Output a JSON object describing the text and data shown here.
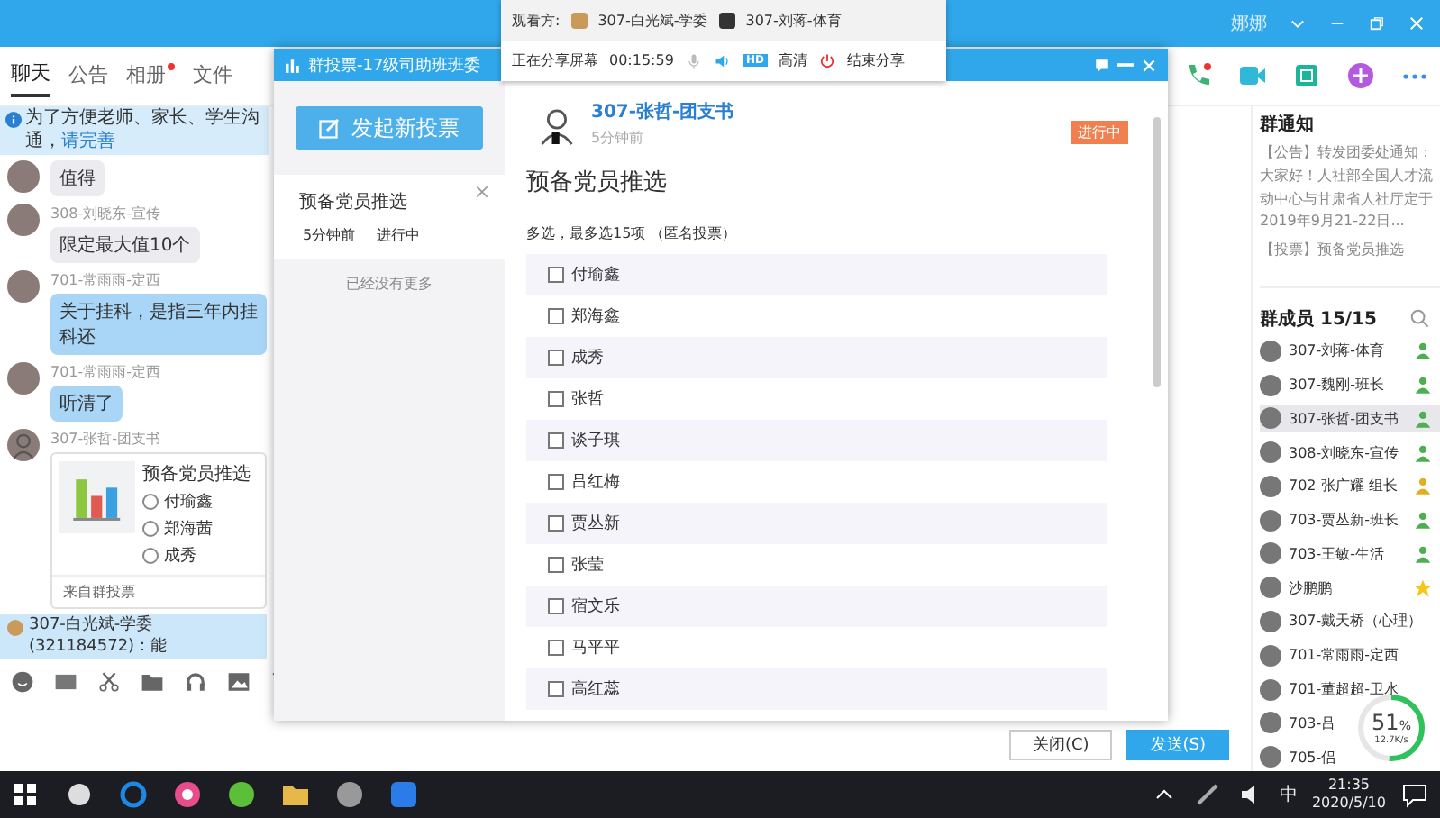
{
  "window": {
    "user": "娜娜"
  },
  "tabs": [
    {
      "label": "聊天",
      "selected": true,
      "has_dot": false
    },
    {
      "label": "公告",
      "selected": false,
      "has_dot": false
    },
    {
      "label": "相册",
      "selected": false,
      "has_dot": true
    },
    {
      "label": "文件",
      "selected": false,
      "has_dot": false
    }
  ],
  "info_bar": {
    "text": "为了方便老师、家长、学生沟通，",
    "link": "请完善"
  },
  "messages": [
    {
      "kind": "text",
      "text": "值得",
      "color": "#ececf0"
    },
    {
      "kind": "text",
      "sender": "308-刘晓东-宣传",
      "text": "限定最大值10个",
      "color": "#ececf0"
    },
    {
      "kind": "text",
      "sender": "701-常雨雨-定西",
      "text": "关于挂科，是指三年内挂科还",
      "color": "#a9d6f7"
    },
    {
      "kind": "text",
      "sender": "701-常雨雨-定西",
      "text": "听清了",
      "color": "#a9d6f7"
    },
    {
      "kind": "vote_card",
      "sender": "307-张哲-团支书",
      "title": "预备党员推选",
      "options": [
        {
          "label": "付瑜鑫",
          "selected": false
        },
        {
          "label": "郑海茜",
          "selected": false
        },
        {
          "label": "成秀",
          "selected": false
        }
      ],
      "footer": "来自群投票"
    }
  ],
  "quote_bar": {
    "text": "307-白光斌-学委(321184572)：能"
  },
  "buttons": [
    {
      "label": "关闭(C)",
      "kind": "plain"
    },
    {
      "label": "发送(S)",
      "kind": "primary"
    }
  ],
  "right_panel": {
    "notice_title": "群通知",
    "notices": [
      "【公告】转发团委处通知：大家好！人社部全国人才流动中心与甘肃省人社厅定于2019年9月21-22日...",
      "【投票】预备党员推选"
    ],
    "members_title": "群成员 15/15",
    "members": [
      {
        "name": "307-刘蒋-体育",
        "selected": false,
        "kind": "member"
      },
      {
        "name": "307-魏刚-班长",
        "selected": false,
        "kind": "member"
      },
      {
        "name": "307-张哲-团支书",
        "selected": true,
        "kind": "member"
      },
      {
        "name": "308-刘晓东-宣传",
        "selected": false,
        "kind": "member"
      },
      {
        "name": "702 张广耀 组长",
        "selected": false,
        "kind": "manager"
      },
      {
        "name": "703-贾丛新-班长",
        "selected": false,
        "kind": "member"
      },
      {
        "name": "703-王敏-生活",
        "selected": false,
        "kind": "member"
      },
      {
        "name": "沙鹏鹏",
        "selected": false,
        "kind": "owner"
      },
      {
        "name": "307-戴天桥（心理）",
        "selected": false,
        "kind": "none"
      },
      {
        "name": "701-常雨雨-定西",
        "selected": false,
        "kind": "none"
      },
      {
        "name": "701-董超超-卫水",
        "selected": false,
        "kind": "none"
      },
      {
        "name": "703-吕",
        "selected": false,
        "kind": "none"
      },
      {
        "name": "705-侣",
        "selected": false,
        "kind": "none"
      }
    ]
  },
  "vote_dialog": {
    "title": "群投票-17级司助班班委",
    "new_button": "发起新投票",
    "list": [
      {
        "title": "预备党员推选",
        "time": "5分钟前",
        "status": "进行中"
      }
    ],
    "list_end": "已经没有更多",
    "detail": {
      "author": "307-张哲-团支书",
      "time": "5分钟前",
      "status": "进行中",
      "title": "预备党员推选",
      "rule": "多选，最多选15项 （匿名投票）",
      "options": [
        {
          "label": "付瑜鑫",
          "checked": false
        },
        {
          "label": "郑海鑫",
          "checked": false
        },
        {
          "label": "成秀",
          "checked": false
        },
        {
          "label": "张哲",
          "checked": false
        },
        {
          "label": "谈子琪",
          "checked": false
        },
        {
          "label": "吕红梅",
          "checked": false
        },
        {
          "label": "贾丛新",
          "checked": false
        },
        {
          "label": "张莹",
          "checked": false
        },
        {
          "label": "宿文乐",
          "checked": false
        },
        {
          "label": "马平平",
          "checked": false
        },
        {
          "label": "高红蕊",
          "checked": false
        }
      ]
    }
  },
  "share_bar": {
    "viewers_label": "观看方:",
    "viewers": [
      "307-白光斌-学委",
      "307-刘蒋-体育"
    ],
    "status": "正在分享屏幕",
    "timer": "00:15:59",
    "quality_badge": "HD",
    "quality": "高清",
    "end": "结束分享"
  },
  "speed": {
    "percent": "51",
    "unit": "%",
    "rate": "12.7K/s",
    "level": 0.51
  },
  "taskbar": {
    "ime": "中",
    "time": "21:35",
    "date": "2020/5/10"
  }
}
